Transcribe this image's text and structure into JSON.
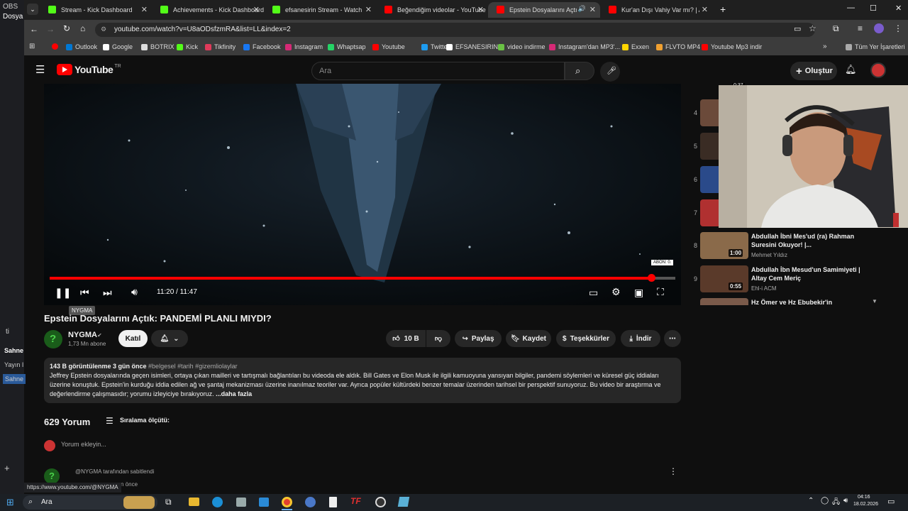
{
  "obs": {
    "title": "OBS",
    "menu": "Dosya",
    "items": [
      "ti",
      "Sahne",
      "Yayın I",
      "Sahne"
    ]
  },
  "tabs": [
    {
      "label": "Stream - Kick Dashboard",
      "color": "#53fc18"
    },
    {
      "label": "Achievements - Kick Dashboard",
      "color": "#53fc18"
    },
    {
      "label": "efsanesirin Stream - Watch Live",
      "color": "#53fc18"
    },
    {
      "label": "Beğendiğim videolar - YouTube",
      "color": "#ff0000"
    },
    {
      "label": "Epstein Dosyalarını Açtık: P",
      "color": "#ff0000"
    },
    {
      "label": "Kur'an Dışı Vahiy Var mı? | Altay",
      "color": "#ff0000"
    }
  ],
  "address": {
    "url": "youtube.com/watch?v=U8aODsfzmRA&list=LL&index=2"
  },
  "bookmarks": [
    {
      "label": "Outlook",
      "color": "#0078d4"
    },
    {
      "label": "Google",
      "color": "#ffffff"
    },
    {
      "label": "BOTRIX",
      "color": "#dddddd"
    },
    {
      "label": "Kick",
      "color": "#53fc18"
    },
    {
      "label": "Tikfinity",
      "color": "#e03a5a"
    },
    {
      "label": "Facebook",
      "color": "#1877f2"
    },
    {
      "label": "Instagram",
      "color": "#d62976"
    },
    {
      "label": "Whaptsap",
      "color": "#25d366"
    },
    {
      "label": "Youtube",
      "color": "#ff0000"
    },
    {
      "label": "Twitter",
      "color": "#1d9bf0"
    },
    {
      "label": "EFSANESIRIN",
      "color": "#ffffff"
    },
    {
      "label": "video indirme",
      "color": "#6ac244"
    },
    {
      "label": "Instagram'dan MP3'...",
      "color": "#d62976"
    },
    {
      "label": "Exxen",
      "color": "#ffd500"
    },
    {
      "label": "FLVTO MP4",
      "color": "#f0a030"
    },
    {
      "label": "Youtube Mp3 indir",
      "color": "#ff0000"
    }
  ],
  "bookmarks_all": "Tüm Yer İşaretleri",
  "yt": {
    "logo": "YouTube",
    "region": "TR",
    "search_placeholder": "Ara",
    "create": "Oluştur"
  },
  "player": {
    "time": "11:20 / 11:47",
    "progress": 0.962,
    "watermark": "ABON: 0.",
    "tooltip": "NYGMA"
  },
  "video": {
    "title": "Epstein Dosyalarını Açtık: PANDEMİ PLANLI MIYDI?",
    "channel": "NYGMA",
    "subscribers": "1,73 Mn abone",
    "join": "Katıl",
    "likes": "10 B",
    "share": "Paylaş",
    "save": "Kaydet",
    "thanks": "Teşekkürler",
    "download": "İndir"
  },
  "description": {
    "meta": "143 B görüntülenme  3 gün önce",
    "tags": "#belgesel #tarih #gizemliolaylar",
    "text": "Jeffrey Epstein dosyalarında geçen isimleri, ortaya çıkan mailleri ve tartışmalı bağlantıları bu videoda ele aldık. Bill Gates ve Elon Musk ile ilgili kamuoyuna yansıyan bilgiler, pandemi söylemleri ve küresel güç iddiaları üzerine konuştuk. Epstein'in kurduğu iddia edilen ağ ve şantaj mekanizması üzerine inanılmaz teoriler var. Ayrıca popüler kültürdeki benzer temalar üzerinden tarihsel bir perspektif sunuyoruz. Bu video bir araştırma ve değerlendirme çalışmasıdır; yorumu izleyiciye bırakıyoruz.",
    "more": "...daha fazla"
  },
  "comments": {
    "count": "629 Yorum",
    "sort": "Sıralama ölçütü:",
    "add": "Yorum ekleyin...",
    "pinned": "@NYGMA tarafından sabitlendi",
    "time": "n önce"
  },
  "playlist": [
    {
      "num": "4",
      "title": "",
      "sub": "",
      "dur": "",
      "color": "#6b4a3a"
    },
    {
      "num": "5",
      "title": "",
      "sub": "",
      "dur": "",
      "color": "#3a2c24"
    },
    {
      "num": "6",
      "title": "",
      "sub": "",
      "dur": "",
      "color": "#2a4a8a"
    },
    {
      "num": "7",
      "title": "",
      "sub": "",
      "dur": "",
      "color": "#b03030"
    },
    {
      "num": "8",
      "title": "Abdullah İbni Mes'ud (ra) Rahman Suresini Okuyor! |...",
      "sub": "Mehmet Yıldız",
      "dur": "1:00",
      "color": "#8a6a4a"
    },
    {
      "num": "9",
      "title": "Abdullah İbn Mesud'un Samimiyeti | Altay Cem Meriç",
      "sub": "Ehl-i ACM",
      "dur": "0:55",
      "color": "#5a3a2a"
    },
    {
      "num": "",
      "title": "Hz Ömer ve Hz Ebubekir'in",
      "sub": "",
      "dur": "",
      "color": "#7a5a4a"
    }
  ],
  "top_dur": "0:37",
  "statusbar": "https://www.youtube.com/@NYGMA",
  "taskbar": {
    "search": "Ara",
    "time": "04:16",
    "date": "18.02.2026"
  }
}
